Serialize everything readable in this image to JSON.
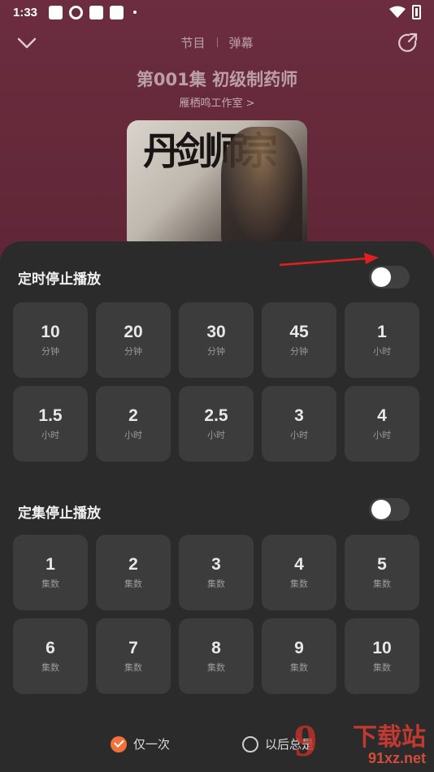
{
  "status_bar": {
    "time": "1:33"
  },
  "header": {
    "tabs": [
      {
        "label": "节目"
      },
      {
        "label": "弹幕"
      }
    ]
  },
  "episode": {
    "title": "第001集 初级制药师",
    "studio": "雁栖鸣工作室 >",
    "cover_text": "丹剑师宗"
  },
  "timer_section": {
    "title": "定时停止播放",
    "toggle_on": false,
    "options": [
      {
        "value": "10",
        "unit": "分钟"
      },
      {
        "value": "20",
        "unit": "分钟"
      },
      {
        "value": "30",
        "unit": "分钟"
      },
      {
        "value": "45",
        "unit": "分钟"
      },
      {
        "value": "1",
        "unit": "小时"
      },
      {
        "value": "1.5",
        "unit": "小时"
      },
      {
        "value": "2",
        "unit": "小时"
      },
      {
        "value": "2.5",
        "unit": "小时"
      },
      {
        "value": "3",
        "unit": "小时"
      },
      {
        "value": "4",
        "unit": "小时"
      }
    ]
  },
  "episode_section": {
    "title": "定集停止播放",
    "toggle_on": false,
    "options": [
      {
        "value": "1",
        "unit": "集数"
      },
      {
        "value": "2",
        "unit": "集数"
      },
      {
        "value": "3",
        "unit": "集数"
      },
      {
        "value": "4",
        "unit": "集数"
      },
      {
        "value": "5",
        "unit": "集数"
      },
      {
        "value": "6",
        "unit": "集数"
      },
      {
        "value": "7",
        "unit": "集数"
      },
      {
        "value": "8",
        "unit": "集数"
      },
      {
        "value": "9",
        "unit": "集数"
      },
      {
        "value": "10",
        "unit": "集数"
      }
    ]
  },
  "footer": {
    "once_label": "仅一次",
    "always_label": "以后总是",
    "selected": "once"
  },
  "watermark": {
    "logo": "9",
    "line1": "下载站",
    "line2": "91xz.net"
  },
  "colors": {
    "accent": "#f2703a",
    "sheet": "#2b2b2b",
    "cell": "#3c3c3c"
  }
}
